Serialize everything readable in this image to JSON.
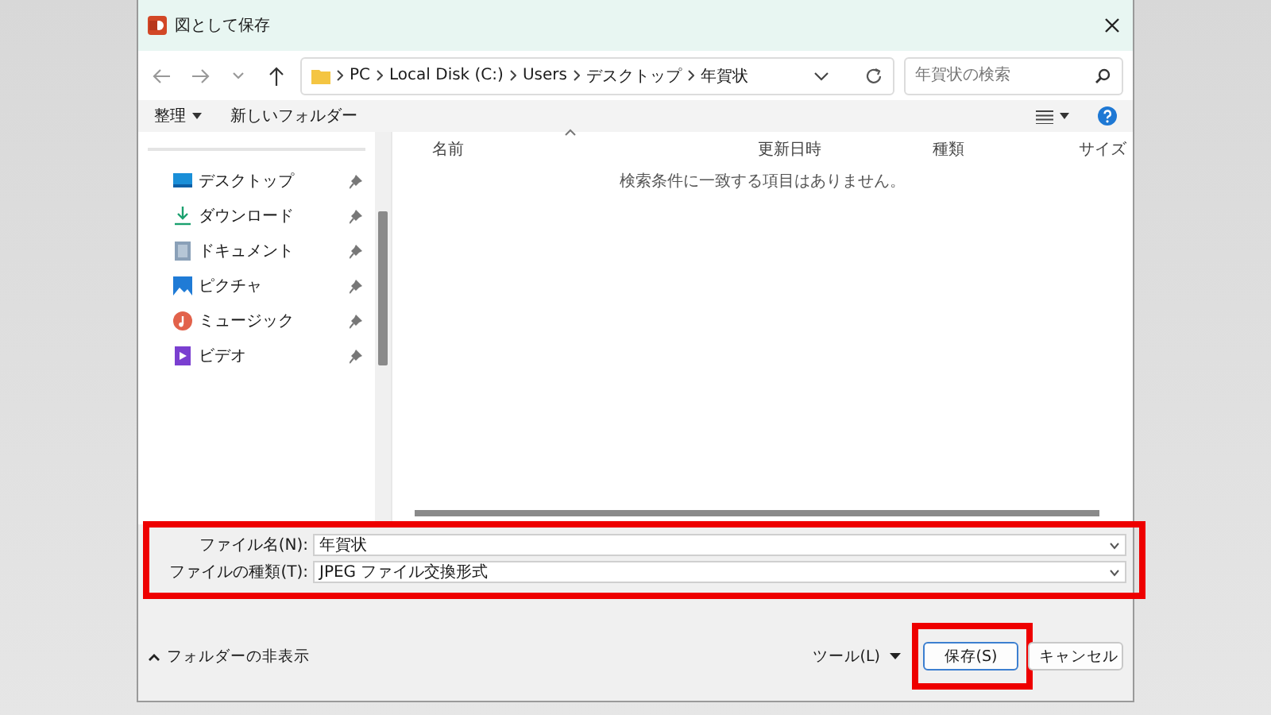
{
  "window": {
    "title": "図として保存"
  },
  "nav": {
    "breadcrumb": [
      "PC",
      "Local Disk (C:)",
      "Users",
      "デスクトップ",
      "年賀状"
    ],
    "search": {
      "placeholder": "年賀状の検索"
    }
  },
  "toolbar": {
    "organize": "整理",
    "new_folder": "新しいフォルダー"
  },
  "sidebar": {
    "items": [
      {
        "label": "デスクトップ",
        "kind": "desktop"
      },
      {
        "label": "ダウンロード",
        "kind": "download"
      },
      {
        "label": "ドキュメント",
        "kind": "document"
      },
      {
        "label": "ピクチャ",
        "kind": "picture"
      },
      {
        "label": "ミュージック",
        "kind": "music"
      },
      {
        "label": "ビデオ",
        "kind": "video"
      }
    ]
  },
  "columns": [
    "名前",
    "更新日時",
    "種類",
    "サイズ"
  ],
  "empty_message": "検索条件に一致する項目はありません。",
  "form": {
    "highlighted": true,
    "fields": [
      {
        "label": "ファイル名(N):",
        "value": "年賀状"
      },
      {
        "label": "ファイルの種類(T):",
        "value": "JPEG ファイル交換形式"
      }
    ]
  },
  "footer": {
    "hide_folders": "フォルダーの非表示",
    "tools": "ツール(L)",
    "buttons": [
      {
        "label": "保存(S)",
        "kind": "primary",
        "highlighted": true
      },
      {
        "label": "キャンセル",
        "kind": "secondary",
        "highlighted": false
      }
    ]
  }
}
